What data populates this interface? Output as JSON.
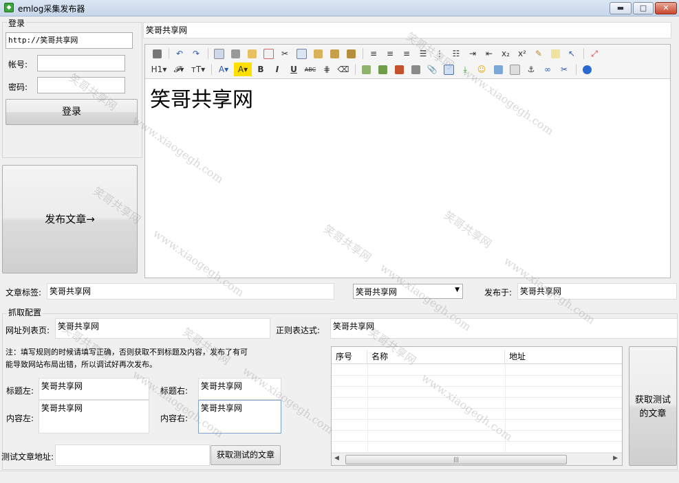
{
  "window": {
    "title": "emlog采集发布器",
    "app_icon": "app-icon",
    "min": "▬",
    "max": "□",
    "close": "✕"
  },
  "login": {
    "group_label": "登录",
    "site_url": "http://笑哥共享网",
    "account_label": "帐号:",
    "account_value": "",
    "password_label": "密码:",
    "password_value": "",
    "login_button": "登录"
  },
  "publish_button": "发布文章→",
  "article": {
    "title_value": "笑哥共享网",
    "editor_text": "笑哥共享网"
  },
  "meta": {
    "tags_label": "文章标签:",
    "tags_value": "笑哥共享网",
    "category_value": "笑哥共享网",
    "published_label": "发布于:",
    "published_value": "笑哥共享网"
  },
  "scrape": {
    "group_label": "抓取配置",
    "list_url_label": "网址列表页:",
    "list_url_value": "笑哥共享网",
    "regex_label": "正则表达式:",
    "regex_value": "笑哥共享网",
    "note_line1": "注：填写规则的时候请填写正确，否则获取不到标题及内容，发布了有可",
    "note_line2": "能导致网站布局出错，所以调试好再次发布。",
    "title_left_label": "标题左:",
    "title_left_value": "笑哥共享网",
    "title_right_label": "标题右:",
    "title_right_value": "笑哥共享网",
    "content_left_label": "内容左:",
    "content_left_value": "笑哥共享网",
    "content_right_label": "内容右:",
    "content_right_value": "笑哥共享网",
    "test_url_label": "测试文章地址:",
    "test_url_value": "",
    "fetch_test_button": "获取测试的文章",
    "fetch_test_big_line1": "获取测试",
    "fetch_test_big_line2": "的文章"
  },
  "grid": {
    "columns": [
      "序号",
      "名称",
      "地址"
    ],
    "scroll_grip": "|||"
  },
  "toolbar": {
    "row1": [
      "source-icon",
      "undo-icon",
      "redo-icon",
      "preview-icon",
      "print-icon",
      "template-icon",
      "code-icon",
      "cut-icon",
      "copy-icon",
      "paste-icon",
      "paste-text-icon",
      "paste-word-icon",
      "align-left-icon",
      "align-center-icon",
      "align-right-icon",
      "justify-icon",
      "ordered-list-icon",
      "unordered-list-icon",
      "indent-icon",
      "outdent-icon",
      "subscript-icon",
      "superscript-icon",
      "clear-format-icon",
      "select-all-icon",
      "cursor-icon",
      "fullscreen-icon"
    ],
    "row2_labels": {
      "heading": "H1▾",
      "font": "𝓕▾",
      "size": "тT▾",
      "font_color": "A▾",
      "bg_color": "A▾",
      "bold": "B",
      "italic": "I",
      "underline": "U",
      "strike": "ABC",
      "sub": "x₂",
      "sup": "x²"
    }
  },
  "watermark": {
    "site": "笑哥共享网",
    "domain": "www.xiaogegh.com"
  },
  "colors": {
    "accent": "#3aa63a",
    "close": "#c8462c"
  }
}
